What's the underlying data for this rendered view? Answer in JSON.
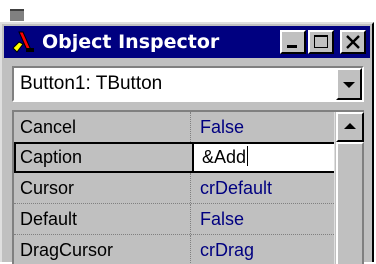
{
  "window": {
    "title": "Object Inspector",
    "icon": "object-inspector-app-icon",
    "title_buttons": [
      "minimize-icon",
      "maximize-icon",
      "close-icon"
    ]
  },
  "component_selector": {
    "value": "Button1: TButton",
    "icon": "chevron-down-icon"
  },
  "properties": [
    {
      "name": "Cancel",
      "value": "False"
    },
    {
      "name": "Caption",
      "value": "&Add"
    },
    {
      "name": "Cursor",
      "value": "crDefault"
    },
    {
      "name": "Default",
      "value": "False"
    },
    {
      "name": "DragCursor",
      "value": "crDrag"
    }
  ],
  "selected_property": "Caption",
  "colors": {
    "titlebar": "#000080",
    "face": "#c0c0c0",
    "value_text": "#000080"
  }
}
